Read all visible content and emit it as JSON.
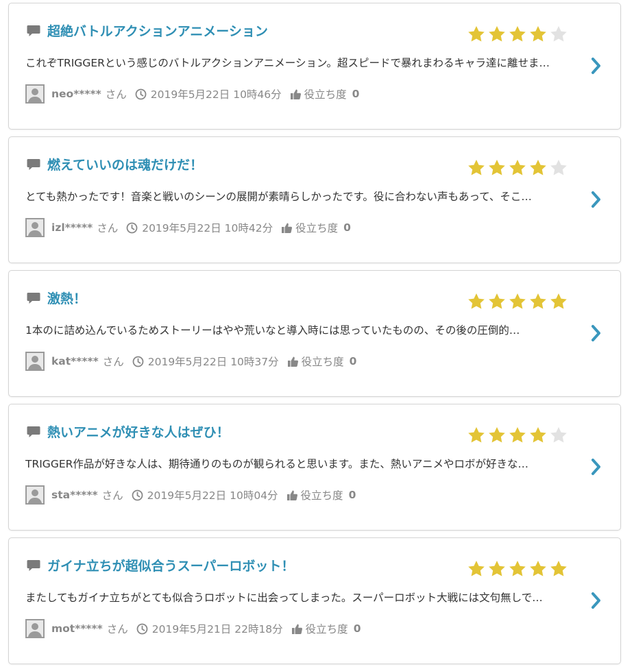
{
  "colors": {
    "title": "#2f8fb4",
    "star_filled": "#e3c436",
    "star_empty": "#e2e2e2",
    "chevron": "#3a97bd",
    "meta": "#888888"
  },
  "icons": {
    "comment": "comment-icon",
    "avatar": "user-avatar-icon",
    "clock": "clock-icon",
    "thumb": "thumbs-up-icon",
    "chevron": "chevron-right-icon",
    "star": "star-icon"
  },
  "labels": {
    "san": "さん",
    "helpful": "役立ち度"
  },
  "reviews": [
    {
      "title": "超絶バトルアクションアニメーション",
      "rating": 4,
      "body": "これぞTRIGGERという感じのバトルアクションアニメーション。超スピードで暴れまわるキャラ達に離せま…",
      "user": "neo*****",
      "timestamp": "2019年5月22日 10時46分",
      "helpful": "0"
    },
    {
      "title": "燃えていいのは魂だけだ！",
      "rating": 4,
      "body": "とても熱かったです！音楽と戦いのシーンの展開が素晴らしかったです。役に合わない声もあって、そこ…",
      "user": "izl*****",
      "timestamp": "2019年5月22日 10時42分",
      "helpful": "0"
    },
    {
      "title": "激熱！",
      "rating": 5,
      "body": "1本のに詰め込んでいるためストーリーはやや荒いなと導入時には思っていたものの、その後の圧倒的…",
      "user": "kat*****",
      "timestamp": "2019年5月22日 10時37分",
      "helpful": "0"
    },
    {
      "title": "熱いアニメが好きな人はぜひ！",
      "rating": 4,
      "body": "TRIGGER作品が好きな人は、期待通りのものが観られると思います。また、熱いアニメやロボが好きな…",
      "user": "sta*****",
      "timestamp": "2019年5月22日 10時04分",
      "helpful": "0"
    },
    {
      "title": "ガイナ立ちが超似合うスーパーロボット！",
      "rating": 5,
      "body": "またしてもガイナ立ちがとても似合うロボットに出会ってしまった。スーパーロボット大戦には文句無しで…",
      "user": "mot*****",
      "timestamp": "2019年5月21日 22時18分",
      "helpful": "0"
    }
  ]
}
